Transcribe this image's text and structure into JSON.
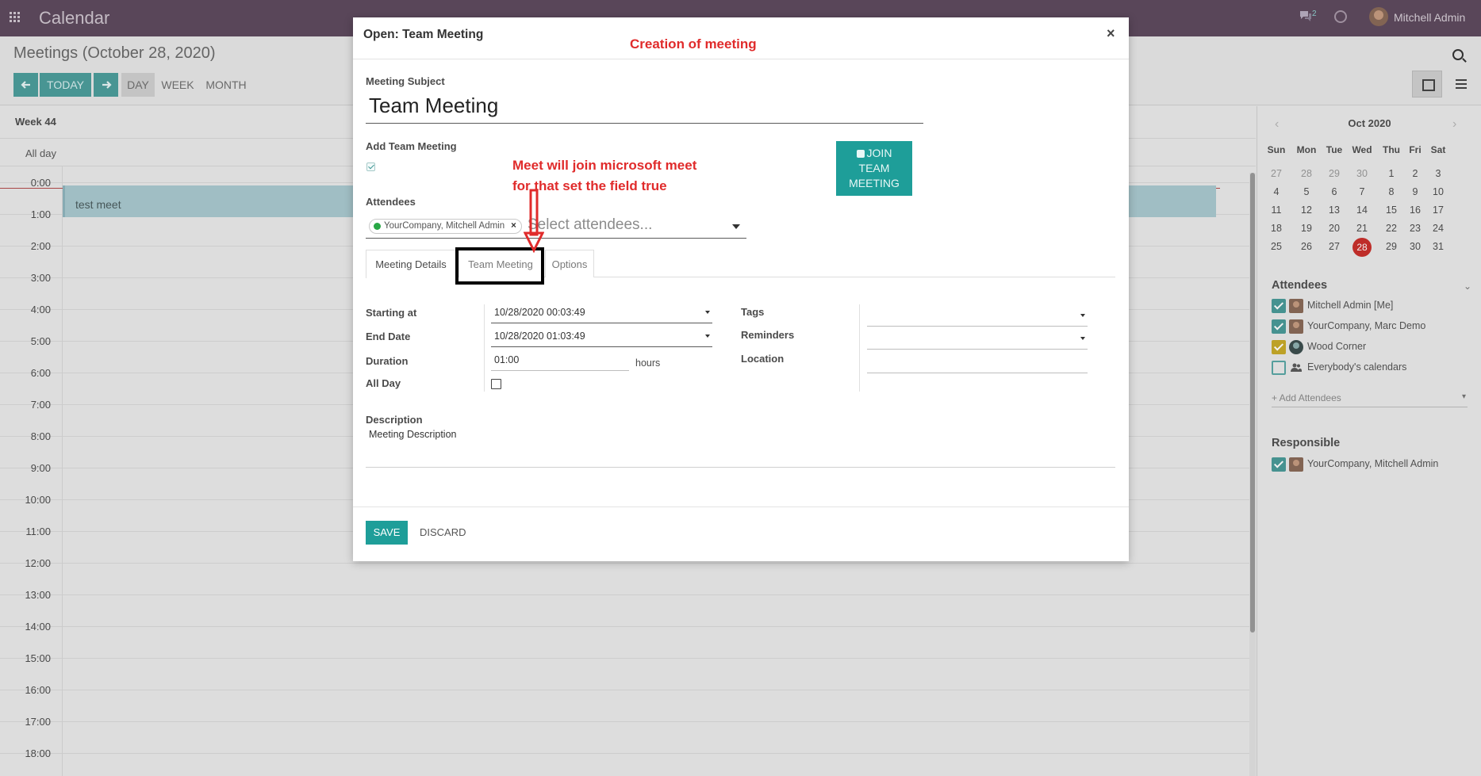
{
  "app": {
    "title": "Calendar"
  },
  "topbar": {
    "chat_count": "2",
    "user_name": "Mitchell Admin"
  },
  "control": {
    "breadcrumb": "Meetings (October 28, 2020)",
    "today_label": "TODAY",
    "views": [
      "DAY",
      "WEEK",
      "MONTH"
    ],
    "active_view": "DAY"
  },
  "calendar": {
    "week_label": "Week 44",
    "allday_label": "All day",
    "hours": [
      "0:00",
      "1:00",
      "2:00",
      "3:00",
      "4:00",
      "5:00",
      "6:00",
      "7:00",
      "8:00",
      "9:00",
      "10:00",
      "11:00",
      "12:00",
      "13:00",
      "14:00",
      "15:00",
      "16:00",
      "17:00",
      "18:00"
    ],
    "event_title": "test meet"
  },
  "sidebar": {
    "mini_title": "Oct 2020",
    "mini_prev": "‹",
    "mini_next": "›",
    "weekdays": [
      "Sun",
      "Mon",
      "Tue",
      "Wed",
      "Thu",
      "Fri",
      "Sat"
    ],
    "weeks": [
      [
        "27",
        "28",
        "29",
        "30",
        "1",
        "2",
        "3"
      ],
      [
        "4",
        "5",
        "6",
        "7",
        "8",
        "9",
        "10"
      ],
      [
        "11",
        "12",
        "13",
        "14",
        "15",
        "16",
        "17"
      ],
      [
        "18",
        "19",
        "20",
        "21",
        "22",
        "23",
        "24"
      ],
      [
        "25",
        "26",
        "27",
        "28",
        "29",
        "30",
        "31"
      ]
    ],
    "today": "28",
    "attendees_title": "Attendees",
    "attendees": [
      "Mitchell Admin [Me]",
      "YourCompany, Marc Demo",
      "Wood Corner",
      "Everybody's calendars"
    ],
    "add_attendees": "+ Add Attendees",
    "responsible_title": "Responsible",
    "responsible": [
      "YourCompany, Mitchell Admin"
    ],
    "colors": {
      "teal": "#4a9a98",
      "yellow": "#c8aa2a"
    }
  },
  "modal": {
    "title": "Open: Team Meeting",
    "close": "×",
    "annotation_top": "Creation of meeting",
    "annotation_mid_1": "Meet will join microsoft meet",
    "annotation_mid_2": "for that set the field true",
    "subject_label": "Meeting Subject",
    "subject_value": "Team Meeting",
    "add_team_label": "Add Team Meeting",
    "add_team_checked": true,
    "join_button": [
      "JOIN",
      "TEAM",
      "MEETING"
    ],
    "attendees_label": "Attendees",
    "attendee_tag": "YourCompany, Mitchell Admin",
    "attendee_tag_remove": "×",
    "attendees_placeholder": "Select attendees...",
    "tabs": [
      "Meeting Details",
      "Team Meeting",
      "Options"
    ],
    "starting_label": "Starting at",
    "starting_value": "10/28/2020 00:03:49",
    "end_label": "End Date",
    "end_value": "10/28/2020 01:03:49",
    "duration_label": "Duration",
    "duration_value": "01:00",
    "hours_label": "hours",
    "allday_label": "All Day",
    "tags_label": "Tags",
    "reminders_label": "Reminders",
    "location_label": "Location",
    "description_label": "Description",
    "description_value": "Meeting Description",
    "save": "SAVE",
    "discard": "DISCARD",
    "accent": "#1e9e99",
    "annotation_color": "#e02b2b"
  }
}
